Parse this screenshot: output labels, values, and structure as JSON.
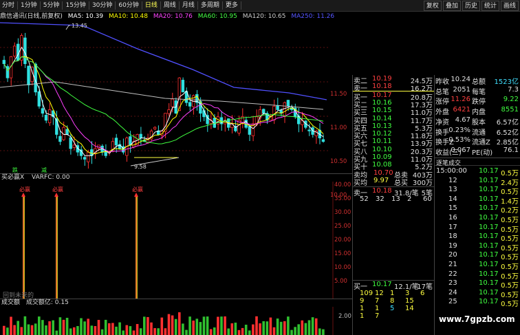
{
  "toolbar": {
    "left": [
      "分时",
      "1分钟",
      "5分钟",
      "15分钟",
      "30分钟",
      "60分钟",
      "日线",
      "周线",
      "月线",
      "多周期",
      "更多"
    ],
    "right": [
      "复权",
      "叠加",
      "历史",
      "统计",
      "画线"
    ],
    "active": "日线"
  },
  "info": {
    "stock": "鼎信通讯(日线,前复权)",
    "ma5": "MA5: 10.39",
    "ma10": "MA10: 10.48",
    "ma20": "MA20: 10.76",
    "ma60": "MA60: 10.95",
    "ma120": "MA120: 10.65",
    "ma250": "MA250: 11.26"
  },
  "colors": {
    "ma5": "#ffffff",
    "ma10": "#ffff00",
    "ma20": "#ff40ff",
    "ma60": "#40ff40",
    "ma120": "#c0c0c0",
    "ma250": "#5050ff",
    "up": "#ff3030",
    "down": "#30e0e0",
    "vol_up": "#ff3030",
    "vol_down": "#30c030"
  },
  "kline": {
    "high_label": "13.45",
    "low_label": "9.58",
    "price_ticks": [
      "11.50",
      "11.00",
      "10.50",
      "10.00"
    ],
    "bottom_labels": [
      "跌",
      "减"
    ]
  },
  "indicator1": {
    "name": "买必赢X",
    "varfc": "VARFC: 0.00",
    "ticks": [
      "40.00",
      "35.00",
      "30.00",
      "25.00",
      "20.00",
      "15.00",
      "10.00",
      "5.00"
    ],
    "signal": "必赢",
    "footer": "回到未来的"
  },
  "indicator2": {
    "name": "成交额",
    "value": "成交额亿: 0.15",
    "ticks": [
      "2.00"
    ]
  },
  "orderbook": {
    "sells": [
      {
        "label": "卖二",
        "price": "10.19",
        "vol": "24.5万"
      },
      {
        "label": "卖一",
        "price": "10.18",
        "vol": "16.2万"
      }
    ],
    "buys": [
      {
        "label": "买一",
        "price": "10.17",
        "vol": "20.8万"
      },
      {
        "label": "买二",
        "price": "10.16",
        "vol": "17.3万"
      },
      {
        "label": "买三",
        "price": "10.15",
        "vol": "11.0万"
      },
      {
        "label": "买四",
        "price": "10.14",
        "vol": "11.7万"
      },
      {
        "label": "买五",
        "price": "10.13",
        "vol": "5.3万"
      },
      {
        "label": "买六",
        "price": "10.12",
        "vol": "11.8万"
      },
      {
        "label": "买七",
        "price": "10.11",
        "vol": "13.9万"
      },
      {
        "label": "买八",
        "price": "10.10",
        "vol": "20.3万"
      },
      {
        "label": "买九",
        "price": "10.09",
        "vol": "11.0万"
      },
      {
        "label": "买十",
        "price": "10.08",
        "vol": "5.2万"
      }
    ],
    "avg": [
      {
        "label": "卖均",
        "price": "10.70",
        "tag": "总卖",
        "vol": "403万"
      },
      {
        "label": "买均",
        "price": "9.97",
        "tag": "总买",
        "vol": "300万"
      }
    ],
    "sell_one_line": {
      "label": "卖一",
      "price": "10.18",
      "vol": "31.8/笔",
      "n": "5笔"
    },
    "sell_one_detail": [
      "52",
      "32",
      "13",
      "2",
      "60"
    ],
    "buy_one_line": {
      "label": "买一",
      "price": "10.17",
      "vol": "12.1/笔",
      "n": "17笔"
    },
    "buy_one_detail": [
      [
        "109",
        "12",
        "1",
        "3",
        "6"
      ],
      [
        "9",
        "7",
        "8",
        "15",
        ""
      ],
      [
        "1",
        "1",
        "5",
        "14",
        ""
      ],
      [
        "1",
        "7",
        "",
        "",
        ""
      ]
    ]
  },
  "quote": {
    "rows": [
      [
        "昨收",
        "10.24",
        "总额",
        "1523亿"
      ],
      [
        "总笔",
        "2051",
        "每笔",
        "7.3"
      ],
      [
        "涨停",
        "11.26",
        "跌停",
        "9.22"
      ],
      [
        "外盘",
        "6421",
        "内盘",
        "8551"
      ],
      [
        "净资",
        "4.67",
        "股本",
        "6.57亿"
      ],
      [
        "换手",
        "0.23%",
        "流通",
        "6.52亿"
      ],
      [
        "换手Z",
        "0.53%",
        "流通Z",
        "2.85亿"
      ],
      [
        "收益(三)",
        "0.067",
        "PE(动)",
        "76.1"
      ]
    ]
  },
  "ticks": {
    "title": "逐笔成交",
    "rows": [
      [
        "15:00:00",
        "10.17",
        "0.5万"
      ],
      [
        "12",
        "10.17",
        "2.4万"
      ],
      [
        "13",
        "10.17",
        "0.5万"
      ],
      [
        "14",
        "10.17",
        "1.4万"
      ],
      [
        "15",
        "10.17",
        "0.2万"
      ],
      [
        "16",
        "10.17",
        "0.5万"
      ],
      [
        "17",
        "10.17",
        "0.5万"
      ],
      [
        "18",
        "10.17",
        "0.5万"
      ],
      [
        "19",
        "10.17",
        "0.5万"
      ],
      [
        "20",
        "10.17",
        "0.5万"
      ],
      [
        "21",
        "10.17",
        "0.5万"
      ],
      [
        "22",
        "10.17",
        "0.5万"
      ],
      [
        "23",
        "10.17",
        "0.5万"
      ],
      [
        "24",
        "10.17",
        "0.5万"
      ],
      [
        "25",
        "10.17",
        "0.5万"
      ]
    ]
  },
  "watermark": "www.7gpzb.com"
}
